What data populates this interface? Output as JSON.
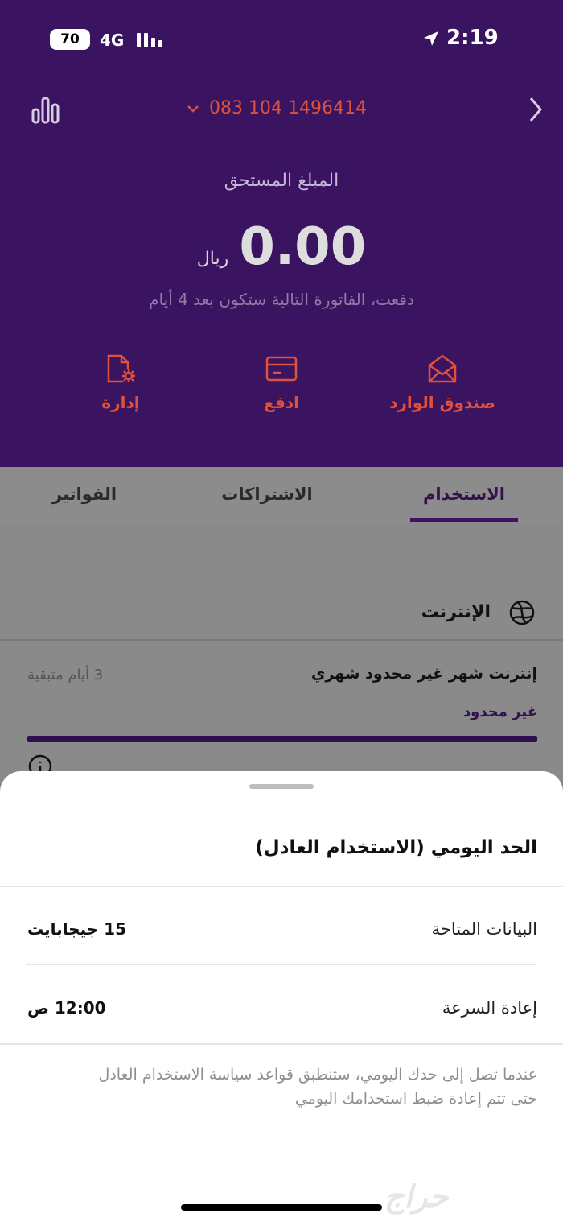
{
  "status_bar": {
    "battery": "70",
    "network": "4G",
    "time": "2:19"
  },
  "header": {
    "phone_number": "083 104 1496414",
    "amount_due_label": "المبلغ المستحق",
    "amount": "0.00",
    "currency": "ريال",
    "next_bill_text": "دفعت، الفاتورة التالية ستكون بعد 4 أيام",
    "actions": [
      {
        "label": "صندوق الوارد",
        "icon": "inbox-icon"
      },
      {
        "label": "ادفع",
        "icon": "card-icon"
      },
      {
        "label": "إدارة",
        "icon": "document-settings-icon"
      }
    ],
    "accent_color": "#e0503a",
    "background_color": "#3a1460"
  },
  "tabs": [
    {
      "label": "الاستخدام",
      "active": true
    },
    {
      "label": "الاشتراكات",
      "active": false
    },
    {
      "label": "الفواتير",
      "active": false
    }
  ],
  "internet": {
    "title": "الإنترنت",
    "plan_name": "إنترنت شهر غير محدود شهري",
    "days_left": "3 أيام متبقية",
    "limit": "غير محدود",
    "usage_fraction": 1.0
  },
  "sheet": {
    "title": "الحد اليومي (الاستخدام العادل)",
    "rows": [
      {
        "label": "البيانات المتاحة",
        "value": "15 جيجابايت"
      },
      {
        "label": "إعادة السرعة",
        "value": "12:00 ص"
      }
    ],
    "note": "عندما تصل إلى حدك اليومي، ستنطبق قواعد سياسة الاستخدام العادل حتى تتم إعادة ضبط استخدامك اليومي"
  },
  "watermark": "حراج"
}
